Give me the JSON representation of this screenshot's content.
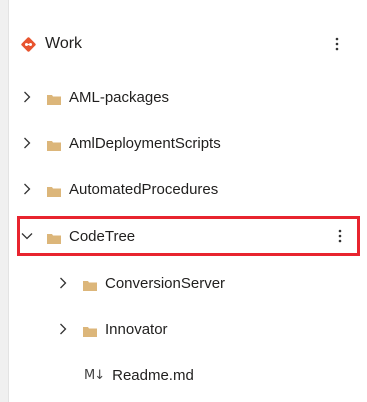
{
  "repo": {
    "name": "Work",
    "icon": "git-diamond-icon",
    "menu_icon": "more-vertical-icon"
  },
  "tree": {
    "items": [
      {
        "label": "AML-packages",
        "type": "folder",
        "expanded": false,
        "level": 0
      },
      {
        "label": "AmlDeploymentScripts",
        "type": "folder",
        "expanded": false,
        "level": 0
      },
      {
        "label": "AutomatedProcedures",
        "type": "folder",
        "expanded": false,
        "level": 0
      },
      {
        "label": "CodeTree",
        "type": "folder",
        "expanded": true,
        "level": 0,
        "selected": true
      },
      {
        "label": "ConversionServer",
        "type": "folder",
        "expanded": false,
        "level": 1
      },
      {
        "label": "Innovator",
        "type": "folder",
        "expanded": false,
        "level": 1
      },
      {
        "label": "Readme.md",
        "type": "markdown-file",
        "level": 1
      }
    ],
    "markdown_icon_text": "M↓"
  },
  "colors": {
    "git_accent": "#e8542f",
    "folder": "#dcb67a",
    "highlight_border": "#e8242f"
  }
}
